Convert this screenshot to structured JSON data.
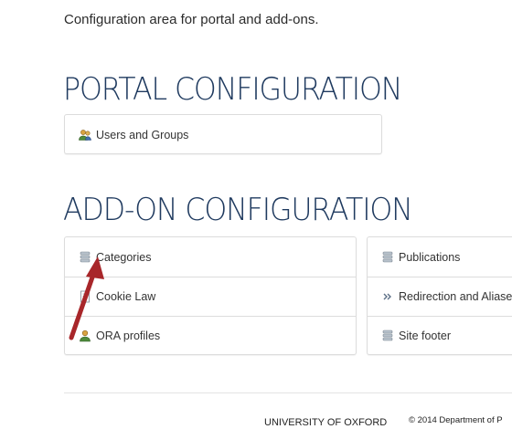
{
  "intro": "Configuration area for portal and add-ons.",
  "portal": {
    "title": "PORTAL CONFIGURATION",
    "items": [
      {
        "label": "Users and Groups",
        "icon": "users-icon"
      }
    ]
  },
  "addons": {
    "title": "ADD-ON CONFIGURATION",
    "left": [
      {
        "label": "Categories",
        "icon": "database-icon"
      },
      {
        "label": "Cookie Law",
        "icon": "document-icon"
      },
      {
        "label": "ORA profiles",
        "icon": "user-icon"
      }
    ],
    "right": [
      {
        "label": "Publications",
        "icon": "database-icon"
      },
      {
        "label": "Redirection and Aliases",
        "icon": "double-chevron-icon"
      },
      {
        "label": "Site footer",
        "icon": "database-icon"
      }
    ]
  },
  "footer": {
    "university": "UNIVERSITY OF OXFORD",
    "copyright": "© 2014 Department of P"
  },
  "colors": {
    "heading": "#1f3a5f",
    "arrow": "#a8262a",
    "border": "#dcdcdc"
  }
}
